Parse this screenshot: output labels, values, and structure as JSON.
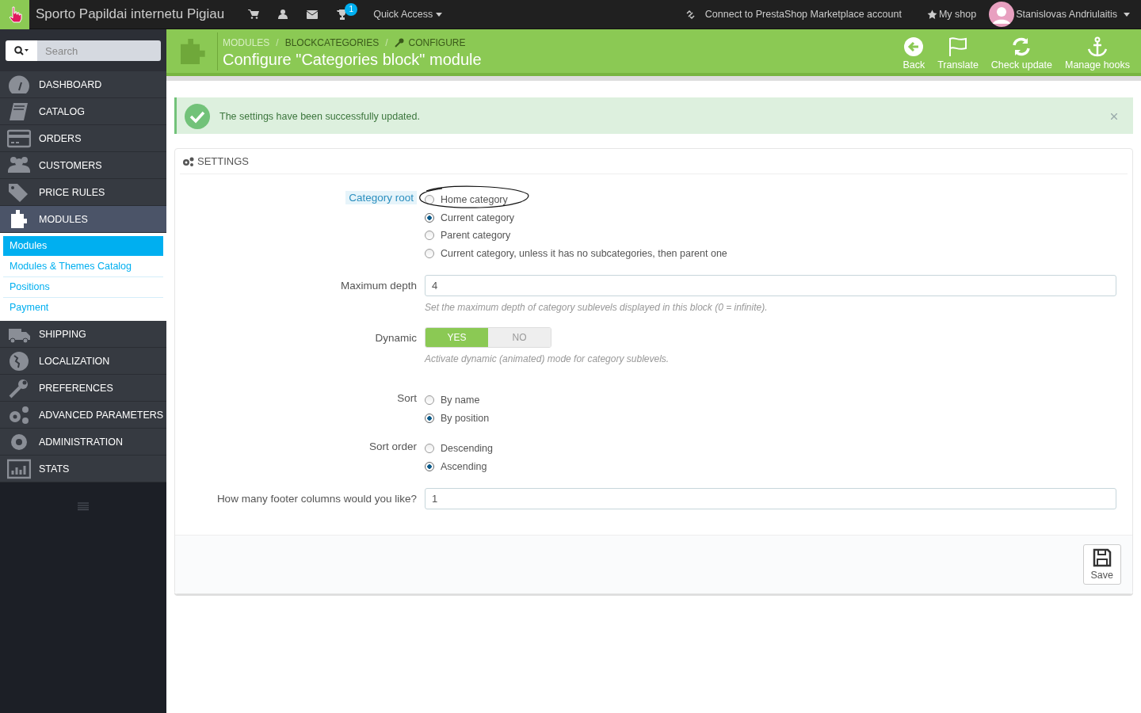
{
  "topbar": {
    "shop_name": "Sporto Papildai internetu Pigiau",
    "notification_count": "1",
    "quick_access": "Quick Access",
    "marketplace": "Connect to PrestaShop Marketplace account",
    "my_shop": "My shop",
    "user": "Stanislovas Andriulaitis"
  },
  "sidebar": {
    "search": {
      "placeholder": "Search"
    },
    "items": [
      {
        "label": "DASHBOARD",
        "selected": false
      },
      {
        "label": "CATALOG",
        "selected": false
      },
      {
        "label": "ORDERS",
        "selected": false
      },
      {
        "label": "CUSTOMERS",
        "selected": false
      },
      {
        "label": "PRICE RULES",
        "selected": false
      },
      {
        "label": "MODULES",
        "selected": true,
        "children": [
          {
            "label": "Modules",
            "selected": true
          },
          {
            "label": "Modules & Themes Catalog",
            "selected": false
          },
          {
            "label": "Positions",
            "selected": false
          },
          {
            "label": "Payment",
            "selected": false
          }
        ]
      },
      {
        "label": "SHIPPING",
        "selected": false
      },
      {
        "label": "LOCALIZATION",
        "selected": false
      },
      {
        "label": "PREFERENCES",
        "selected": false
      },
      {
        "label": "ADVANCED PARAMETERS",
        "selected": false
      },
      {
        "label": "ADMINISTRATION",
        "selected": false
      },
      {
        "label": "STATS",
        "selected": false
      }
    ]
  },
  "page_header": {
    "breadcrumb_separator": "/",
    "breadcrumb": [
      "MODULES",
      "BLOCKCATEGORIES",
      "CONFIGURE"
    ],
    "title": "Configure \"Categories block\" module",
    "toolbar": [
      {
        "label": "Back"
      },
      {
        "label": "Translate"
      },
      {
        "label": "Check update"
      },
      {
        "label": "Manage hooks"
      }
    ]
  },
  "alert": {
    "message": "The settings have been successfully updated."
  },
  "panel": {
    "heading": "SETTINGS",
    "fields": [
      {
        "kind": "radio",
        "label": "Category root",
        "highlighted": true,
        "options": [
          {
            "label": "Home category",
            "selected": false,
            "circled": true
          },
          {
            "label": "Current category",
            "selected": true,
            "circled": false
          },
          {
            "label": "Parent category",
            "selected": false,
            "circled": false
          },
          {
            "label": "Current category, unless it has no subcategories, then parent one",
            "selected": false,
            "circled": false
          }
        ]
      },
      {
        "kind": "text",
        "label": "Maximum depth",
        "value": "4",
        "help": "Set the maximum depth of category sublevels displayed in this block (0 = infinite)."
      },
      {
        "kind": "switch",
        "label": "Dynamic",
        "on": true,
        "yes": "YES",
        "no": "NO",
        "help": "Activate dynamic (animated) mode for category sublevels."
      },
      {
        "kind": "radio",
        "label": "Sort",
        "highlighted": false,
        "options": [
          {
            "label": "By name",
            "selected": false,
            "circled": false
          },
          {
            "label": "By position",
            "selected": true,
            "circled": false
          }
        ]
      },
      {
        "kind": "radio",
        "label": "Sort order",
        "highlighted": false,
        "options": [
          {
            "label": "Descending",
            "selected": false,
            "circled": false
          },
          {
            "label": "Ascending",
            "selected": true,
            "circled": false
          }
        ]
      },
      {
        "kind": "text",
        "label": "How many footer columns would you like?",
        "value": "1"
      }
    ],
    "save": "Save"
  }
}
